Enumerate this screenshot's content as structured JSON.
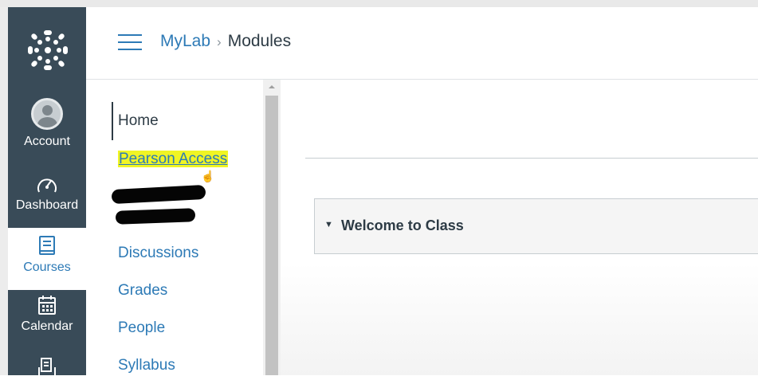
{
  "global_nav": {
    "account": "Account",
    "dashboard": "Dashboard",
    "courses": "Courses",
    "calendar": "Calendar"
  },
  "header": {
    "breadcrumb_course": "MyLab",
    "breadcrumb_separator": "›",
    "breadcrumb_current": "Modules"
  },
  "course_nav": {
    "items": [
      {
        "label": "Home"
      },
      {
        "label": "Pearson Access"
      },
      {
        "label": "Discussions"
      },
      {
        "label": "Grades"
      },
      {
        "label": "People"
      },
      {
        "label": "Syllabus"
      }
    ]
  },
  "main": {
    "module_title": "Welcome to Class"
  },
  "colors": {
    "nav_bg": "#394b58",
    "link": "#2d7ab6",
    "highlight": "#f0f524",
    "text": "#2d3b45"
  }
}
